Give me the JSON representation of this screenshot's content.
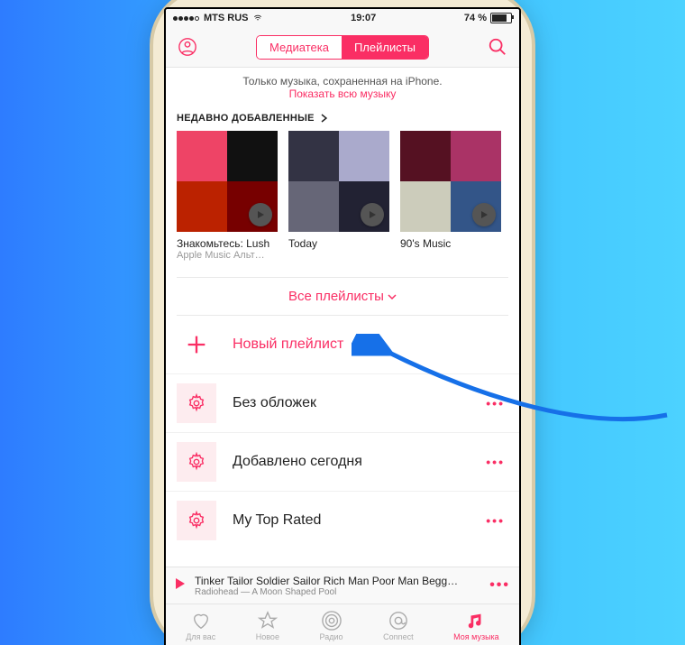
{
  "status": {
    "carrier": "MTS RUS",
    "time": "19:07",
    "battery_pct": "74 %"
  },
  "nav": {
    "seg_library": "Медиатека",
    "seg_playlists": "Плейлисты"
  },
  "banner": {
    "line1": "Только музыка, сохраненная на iPhone.",
    "line2": "Показать всю музыку"
  },
  "recent": {
    "header": "НЕДАВНО ДОБАВЛЕННЫЕ",
    "items": [
      {
        "title": "Знакомьтесь: Lush",
        "subtitle": "Apple Music Альт…"
      },
      {
        "title": "Today",
        "subtitle": ""
      },
      {
        "title": "90's Music",
        "subtitle": ""
      }
    ]
  },
  "filter": "Все плейлисты",
  "rows": {
    "new": "Новый плейлист",
    "items": [
      {
        "label": "Без обложек"
      },
      {
        "label": "Добавлено сегодня"
      },
      {
        "label": "My Top Rated"
      }
    ]
  },
  "now_playing": {
    "title": "Tinker Tailor Soldier Sailor Rich Man Poor Man Begg…",
    "subtitle": "Radiohead — A Moon Shaped Pool"
  },
  "tabs": {
    "for_you": "Для вас",
    "new": "Новое",
    "radio": "Радио",
    "connect": "Connect",
    "my_music": "Моя музыка"
  },
  "colors": {
    "accent": "#fa2e64"
  }
}
